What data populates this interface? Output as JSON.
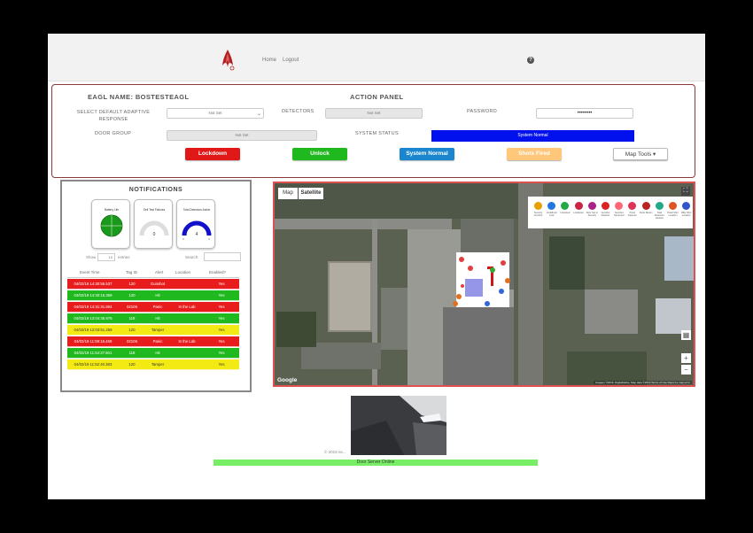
{
  "nav": {
    "home": "Home",
    "logout": "Logout",
    "help_icon": "question-circle-icon"
  },
  "action_panel": {
    "eagl_name": "EAGL NAME: BOSTESTEAGL",
    "title": "ACTION PANEL",
    "default_response_label": "SELECT DEFAULT ADAPTIVE RESPONSE",
    "default_response_value": "Not Set",
    "detectors_label": "DETECTORS",
    "detectors_value": "Not Set",
    "password_label": "PASSWORD",
    "password_value": "••••••••",
    "door_group_label": "DOOR GROUP",
    "door_group_value": "Not Set",
    "system_status_label": "SYSTEM STATUS",
    "system_status_value": "System Normal",
    "buttons": {
      "lockdown": "Lockdown",
      "unlock": "Unlock",
      "system_normal": "System Normal",
      "shots_fired": "Shots Fired",
      "map_tools": "Map Tools ▾"
    },
    "colors": {
      "lockdown": "#e01818",
      "unlock": "#1fb81f",
      "system_normal": "#1a86d0",
      "shots_fired": "#ffc77a",
      "status_bar": "#0011ee"
    }
  },
  "notifications": {
    "title": "NOTIFICATIONS",
    "gauges": [
      {
        "label": "Battery Life",
        "value": ""
      },
      {
        "label": "Self Test Failures",
        "value": "0"
      },
      {
        "label": "Total Detectors Active",
        "value": "4",
        "min": "0",
        "max": "4"
      }
    ],
    "show_label": "Show",
    "entries_label": "entries",
    "show_value": "10",
    "search_label": "Search:",
    "columns": [
      "Event Time",
      "Tag ID",
      "Alert",
      "Location",
      "Enabled?"
    ],
    "rows": [
      {
        "time": "04/02/19 14:30:55.537",
        "tag": "120",
        "alert": "Gunshot",
        "location": "",
        "enabled": "Yes",
        "color": "red"
      },
      {
        "time": "04/02/19 14:30:15.359",
        "tag": "120",
        "alert": "Hit",
        "location": "",
        "enabled": "Yes",
        "color": "green"
      },
      {
        "time": "04/02/19 14:31:31.804",
        "tag": "02106",
        "alert": "Panic",
        "location": "In the Lab",
        "enabled": "Yes",
        "color": "red"
      },
      {
        "time": "04/02/19 13:04:35.976",
        "tag": "118",
        "alert": "Hit",
        "location": "",
        "enabled": "Yes",
        "color": "green"
      },
      {
        "time": "04/02/19 12:03:51.259",
        "tag": "120",
        "alert": "Tamper",
        "location": "",
        "enabled": "Yes",
        "color": "yellow"
      },
      {
        "time": "04/02/19 11:59:16.469",
        "tag": "02106",
        "alert": "Panic",
        "location": "In the Lab",
        "enabled": "Yes",
        "color": "red"
      },
      {
        "time": "04/02/19 11:54:37.501",
        "tag": "118",
        "alert": "Hit",
        "location": "",
        "enabled": "Yes",
        "color": "green"
      },
      {
        "time": "04/02/19 11:52:40.383",
        "tag": "120",
        "alert": "Tamper",
        "location": "",
        "enabled": "Yes",
        "color": "yellow"
      }
    ]
  },
  "map": {
    "tab_map": "Map",
    "tab_satellite": "Satellite",
    "google": "Google",
    "attribution": "Imagery ©2019, DigitalGlobe, Map data ©2019  Terms of Use  Report a map error",
    "legend": [
      {
        "label": "Security Gunshot",
        "color": "#e8a000"
      },
      {
        "label": "Undefined Lock",
        "color": "#2277dd"
      },
      {
        "label": "Unlocked",
        "color": "#22aa44"
      },
      {
        "label": "Lockdown",
        "color": "#cc2244"
      },
      {
        "label": "Door Set to Security",
        "color": "#aa2288"
      },
      {
        "label": "Gunshot Detector",
        "color": "#dd2222"
      },
      {
        "label": "Gunshot Tampered",
        "color": "#ff6677"
      },
      {
        "label": "Panic Detector",
        "color": "#dd3355"
      },
      {
        "label": "Panic Button",
        "color": "#bb2222"
      },
      {
        "label": "Total Detectors Caution",
        "color": "#22aa88"
      },
      {
        "label": "Pistol Shot Location",
        "color": "#dd5522"
      },
      {
        "label": "Rifle Shot Location",
        "color": "#3355cc"
      }
    ]
  },
  "footer": {
    "copyright": "© 2019 ne...",
    "door_server": "Door Server Online",
    "door_server_color": "#77ee66"
  }
}
